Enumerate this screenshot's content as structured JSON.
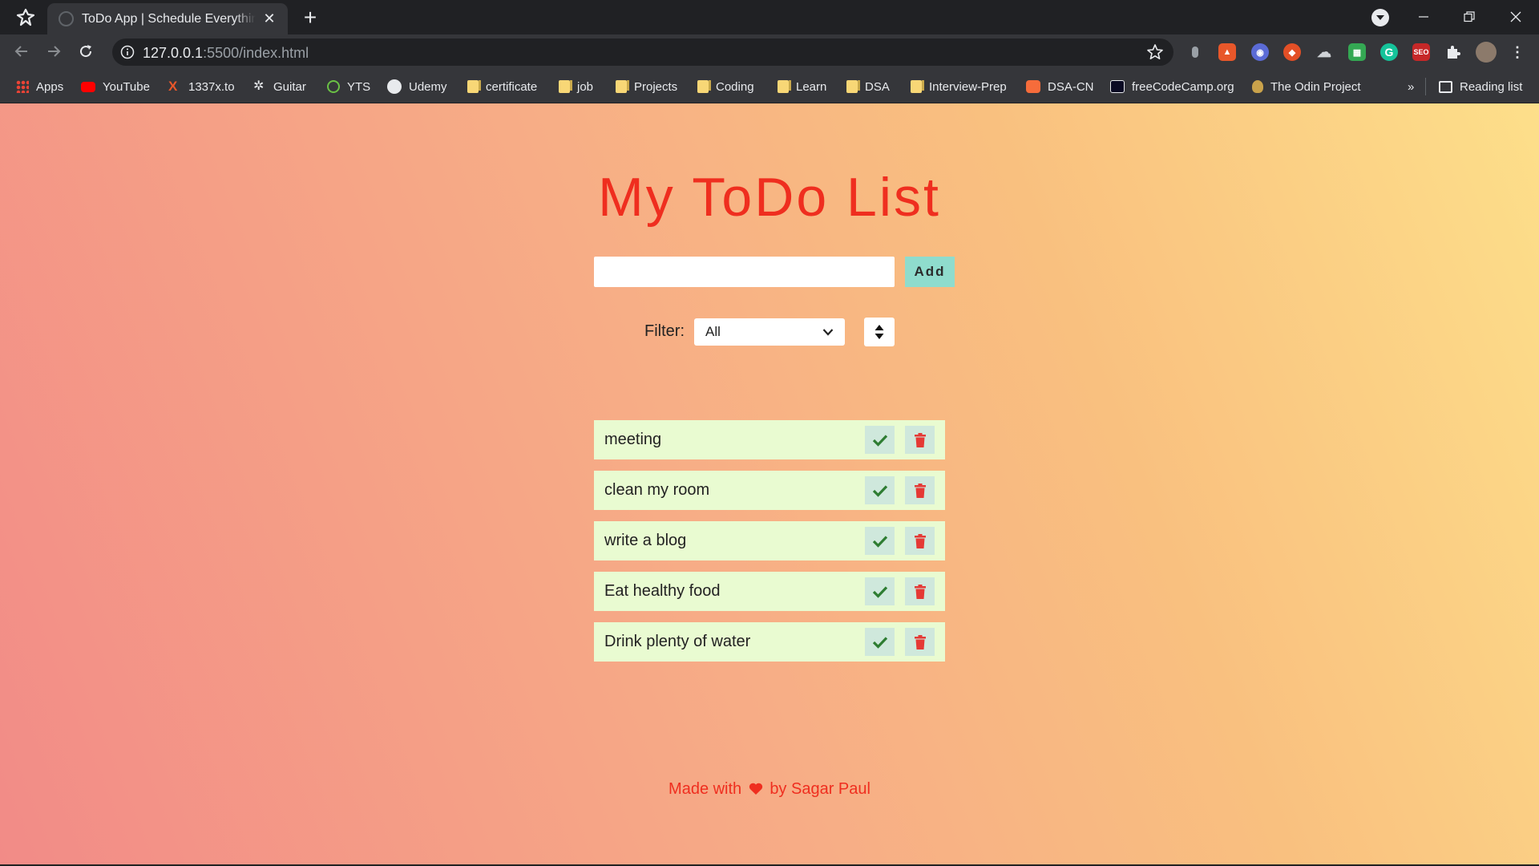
{
  "browser": {
    "tab_title": "ToDo App | Schedule Everything",
    "url_host": "127.0.0.1",
    "url_path": ":5500/index.html",
    "bookmarks": [
      {
        "label": "Apps"
      },
      {
        "label": "YouTube"
      },
      {
        "label": "1337x.to"
      },
      {
        "label": "Guitar"
      },
      {
        "label": "YTS"
      },
      {
        "label": "Udemy"
      },
      {
        "label": "certificate"
      },
      {
        "label": "job"
      },
      {
        "label": "Projects"
      },
      {
        "label": "Coding"
      },
      {
        "label": "Learn"
      },
      {
        "label": "DSA"
      },
      {
        "label": "Interview-Prep"
      },
      {
        "label": "DSA-CN"
      },
      {
        "label": "freeCodeCamp.org"
      },
      {
        "label": "The Odin Project"
      }
    ],
    "overflow": "»",
    "reading_list": "Reading list"
  },
  "app": {
    "title": "My ToDo List",
    "input_placeholder": "",
    "add_label": "Add",
    "filter_label": "Filter:",
    "filter_value": "All",
    "todos": [
      {
        "text": "meeting"
      },
      {
        "text": "clean my room"
      },
      {
        "text": "write a blog"
      },
      {
        "text": "Eat healthy food"
      },
      {
        "text": "Drink plenty of water"
      }
    ],
    "footer_prefix": "Made with",
    "footer_suffix": "by Sagar Paul"
  },
  "colors": {
    "title": "#ef2e1f",
    "add_button": "#8fdccd",
    "todo_item": "#e9fbd1",
    "check": "#2e7d32",
    "trash": "#e53935"
  }
}
